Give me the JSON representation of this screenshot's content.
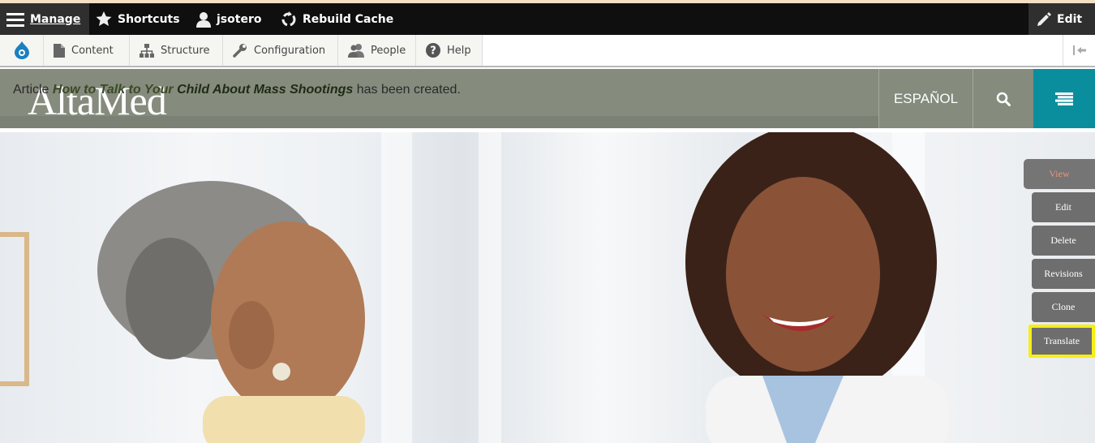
{
  "toolbar": {
    "manage": "Manage",
    "shortcuts": "Shortcuts",
    "user": "jsotero",
    "rebuild_cache": "Rebuild Cache",
    "edit": "Edit"
  },
  "tray": {
    "items": [
      {
        "label": "Content",
        "icon": "file-icon"
      },
      {
        "label": "Structure",
        "icon": "sitemap-icon"
      },
      {
        "label": "Configuration",
        "icon": "wrench-icon"
      },
      {
        "label": "People",
        "icon": "people-icon"
      },
      {
        "label": "Help",
        "icon": "help-icon"
      }
    ]
  },
  "header": {
    "logo": "AltaMed",
    "language": "ESPAÑOL"
  },
  "status": {
    "prefix": "Article ",
    "link_part_a": "How to Talk to Your",
    "link_part_b": " Child About Mass Shootings",
    "suffix": " has been created."
  },
  "tabs": {
    "view": "View",
    "edit": "Edit",
    "delete": "Delete",
    "revisions": "Revisions",
    "clone": "Clone",
    "translate": "Translate"
  },
  "colors": {
    "toolbar_bg": "#0f0f0f",
    "header_bg": "#858b7d",
    "menu_accent": "#0a8e9e",
    "tab_bg": "#6e6e6e",
    "highlight": "#f7ef14"
  }
}
